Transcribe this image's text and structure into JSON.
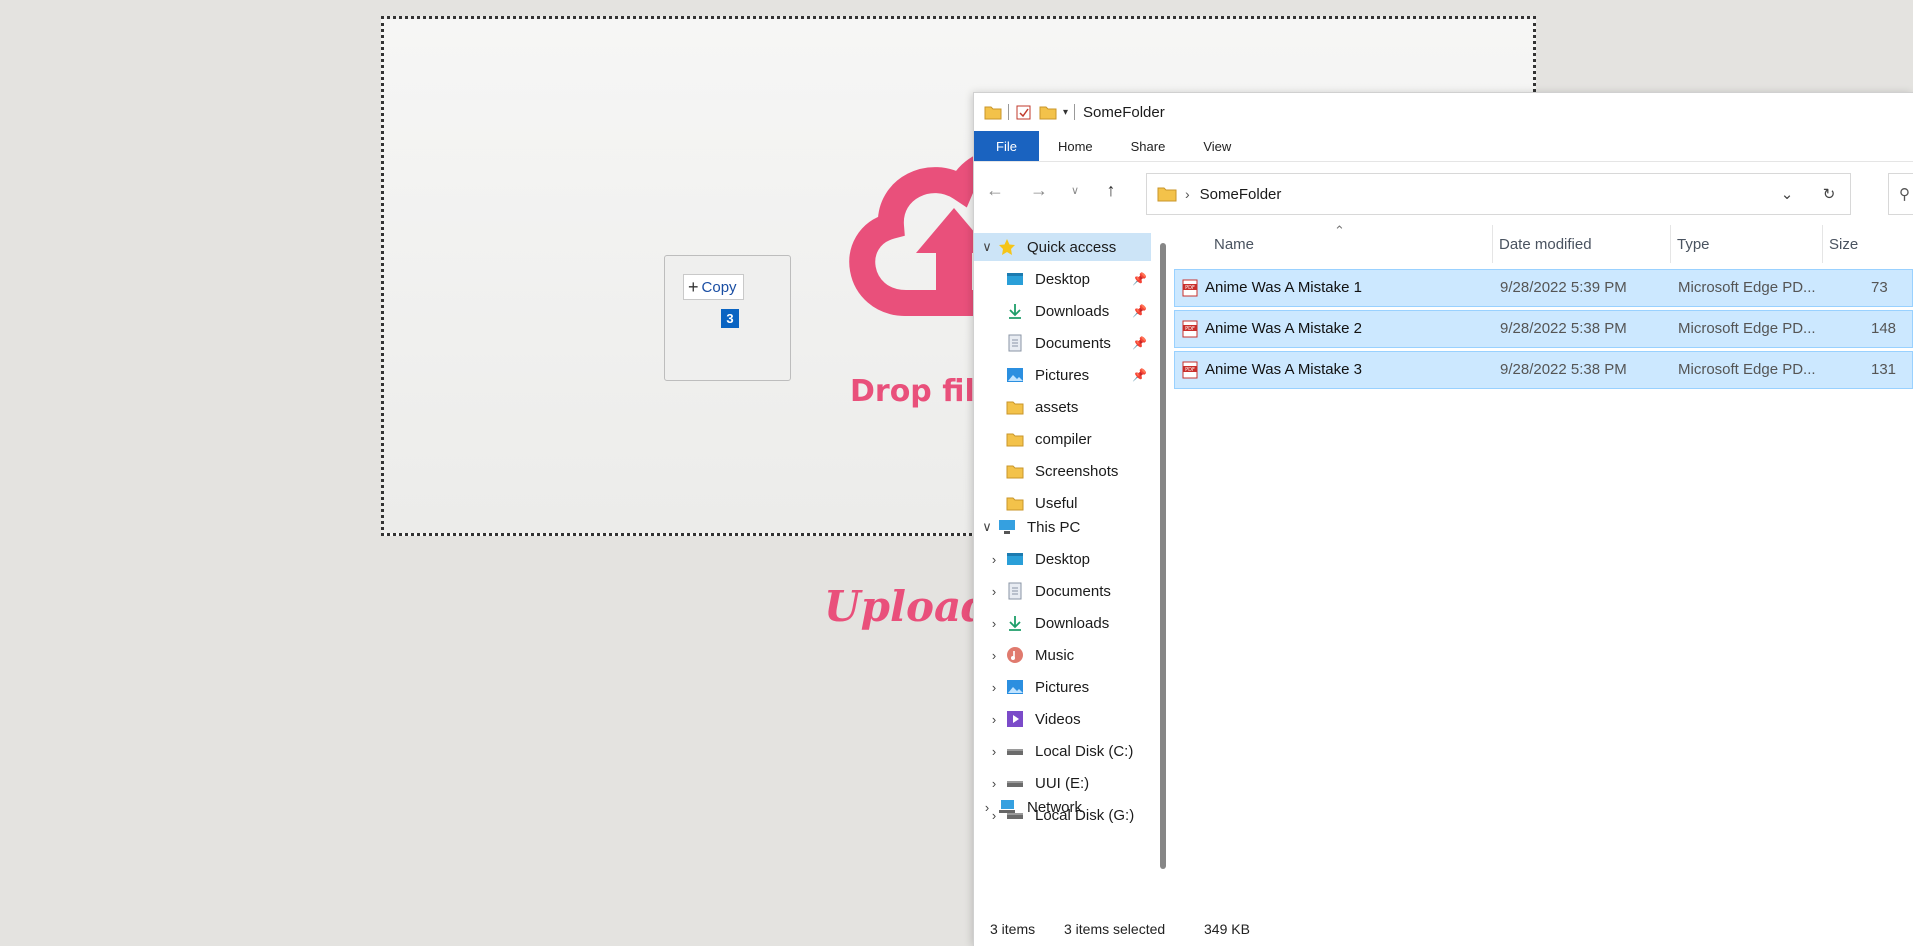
{
  "webpage": {
    "drop_text": "Drop files",
    "upload_title": "Uploade",
    "drag_ghost": {
      "copy_label": "Copy",
      "count": "3"
    },
    "colors": {
      "accent": "#e9507b"
    }
  },
  "explorer": {
    "title": "SomeFolder",
    "ribbon_tabs": [
      "File",
      "Home",
      "Share",
      "View"
    ],
    "address": {
      "folder": "SomeFolder"
    },
    "nav": {
      "quick_access": {
        "label": "Quick access",
        "items": [
          {
            "label": "Desktop",
            "icon": "desktop-icon",
            "pinned": true
          },
          {
            "label": "Downloads",
            "icon": "download-icon",
            "pinned": true
          },
          {
            "label": "Documents",
            "icon": "documents-icon",
            "pinned": true
          },
          {
            "label": "Pictures",
            "icon": "pictures-icon",
            "pinned": true
          },
          {
            "label": "assets",
            "icon": "folder-icon",
            "pinned": false
          },
          {
            "label": "compiler",
            "icon": "folder-icon",
            "pinned": false
          },
          {
            "label": "Screenshots",
            "icon": "folder-icon",
            "pinned": false
          },
          {
            "label": "Useful",
            "icon": "folder-icon",
            "pinned": false
          }
        ]
      },
      "this_pc": {
        "label": "This PC",
        "items": [
          {
            "label": "Desktop",
            "icon": "desktop-icon"
          },
          {
            "label": "Documents",
            "icon": "documents-icon"
          },
          {
            "label": "Downloads",
            "icon": "download-icon"
          },
          {
            "label": "Music",
            "icon": "music-icon"
          },
          {
            "label": "Pictures",
            "icon": "pictures-icon"
          },
          {
            "label": "Videos",
            "icon": "videos-icon"
          },
          {
            "label": "Local Disk (C:)",
            "icon": "drive-icon"
          },
          {
            "label": "UUI (E:)",
            "icon": "drive-icon"
          },
          {
            "label": "Local Disk (G:)",
            "icon": "drive-icon"
          }
        ]
      },
      "network": {
        "label": "Network"
      }
    },
    "columns": {
      "name": "Name",
      "date": "Date modified",
      "type": "Type",
      "size": "Size"
    },
    "files": [
      {
        "name": "Anime Was A Mistake 1",
        "date": "9/28/2022 5:39 PM",
        "type": "Microsoft Edge PD...",
        "size": "73"
      },
      {
        "name": "Anime Was A Mistake 2",
        "date": "9/28/2022 5:38 PM",
        "type": "Microsoft Edge PD...",
        "size": "148"
      },
      {
        "name": "Anime Was A Mistake 3",
        "date": "9/28/2022 5:38 PM",
        "type": "Microsoft Edge PD...",
        "size": "131"
      }
    ],
    "status": {
      "items": "3 items",
      "selected": "3 items selected",
      "size": "349 KB"
    }
  }
}
